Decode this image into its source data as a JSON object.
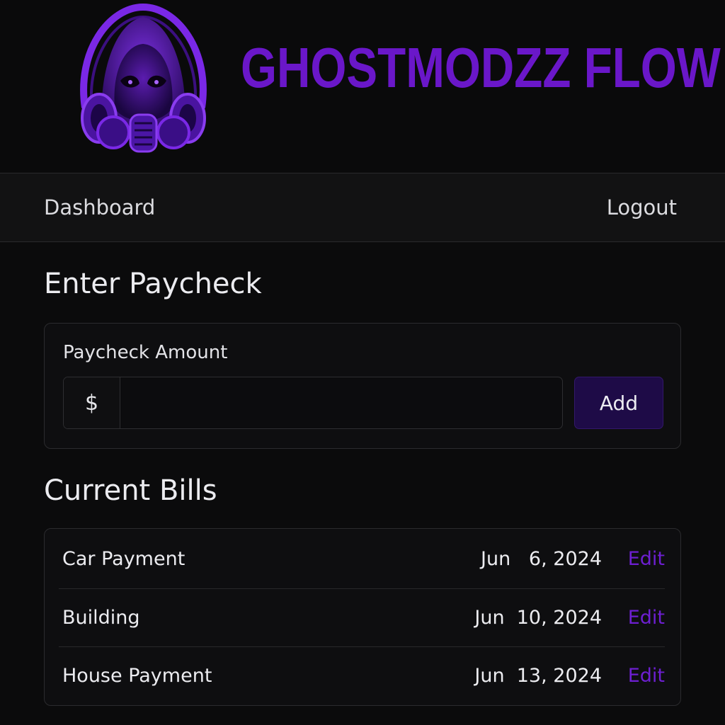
{
  "header": {
    "brand_title": "GHOSTMODZZ FLOW",
    "logo_icon": "gas-mask-skull-headphones-icon"
  },
  "nav": {
    "dashboard_label": "Dashboard",
    "logout_label": "Logout"
  },
  "paycheck": {
    "title": "Enter Paycheck",
    "field_label": "Paycheck Amount",
    "currency_prefix": "$",
    "amount_value": "",
    "add_label": "Add"
  },
  "bills": {
    "title": "Current Bills",
    "items": [
      {
        "name": "Car Payment",
        "date": "Jun   6, 2024",
        "edit_label": "Edit"
      },
      {
        "name": "Building",
        "date": "Jun  10, 2024",
        "edit_label": "Edit"
      },
      {
        "name": "House Payment",
        "date": "Jun  13, 2024",
        "edit_label": "Edit"
      }
    ]
  },
  "colors": {
    "background": "#0b0b0c",
    "accent_purple": "#6a17c9",
    "button_bg": "#1e0b47",
    "link_purple": "#6d1fd1"
  }
}
